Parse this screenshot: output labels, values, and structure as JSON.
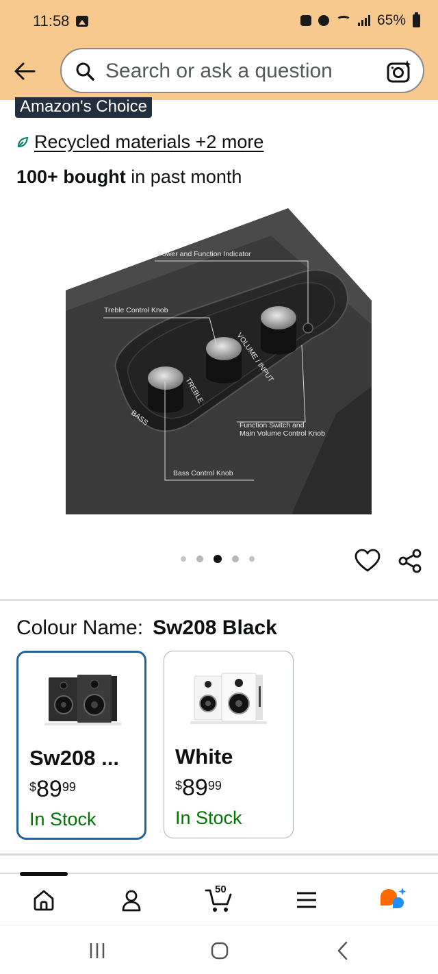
{
  "status_bar": {
    "time": "11:58",
    "battery": "65%",
    "icons": [
      "gallery-icon",
      "sim-icon",
      "alarm-icon",
      "wifi-icon",
      "signal-icon",
      "battery-icon"
    ]
  },
  "header": {
    "back_icon": "arrow-left-icon",
    "search_placeholder": "Search or ask a question",
    "camera_icon": "camera-lens-icon",
    "background_color": "#f7c98f"
  },
  "product": {
    "badge": "Amazon's Choice",
    "recycled_text": "Recycled materials +2 more",
    "bought_bold": "100+ bought",
    "bought_rest": " in past month",
    "image_callouts": {
      "power": "Power and Function Indicator",
      "treble": "Treble Control Knob",
      "function_line1": "Function Switch and",
      "function_line2": "Main Volume Control Knob",
      "bass": "Bass Control Knob",
      "knob_label_bass": "BASS",
      "knob_label_treble": "TREBLE",
      "knob_label_volume": "VOLUME / INPUT"
    },
    "carousel": {
      "total": 5,
      "current": 3
    }
  },
  "colour": {
    "label": "Colour Name:",
    "selected_value": "Sw208 Black",
    "options": [
      {
        "name": "Sw208 ...",
        "currency": "$",
        "whole": "89",
        "fraction": "99",
        "stock": "In Stock",
        "selected": true,
        "swatch": "black-speakers"
      },
      {
        "name": "White",
        "currency": "$",
        "whole": "89",
        "fraction": "99",
        "stock": "In Stock",
        "selected": false,
        "swatch": "white-speakers"
      }
    ]
  },
  "bottom_nav": {
    "items": [
      "home-icon",
      "account-icon",
      "cart-icon",
      "menu-icon",
      "rufus-icon"
    ],
    "cart_count": "50"
  },
  "system_nav": [
    "recents-icon",
    "home-circle-icon",
    "back-chevron-icon"
  ],
  "colors": {
    "accent_link": "#2162a1",
    "in_stock": "#007600",
    "badge_bg": "#232f3e",
    "rufus_orange": "#ff6a00",
    "rufus_blue": "#1f8fff"
  }
}
